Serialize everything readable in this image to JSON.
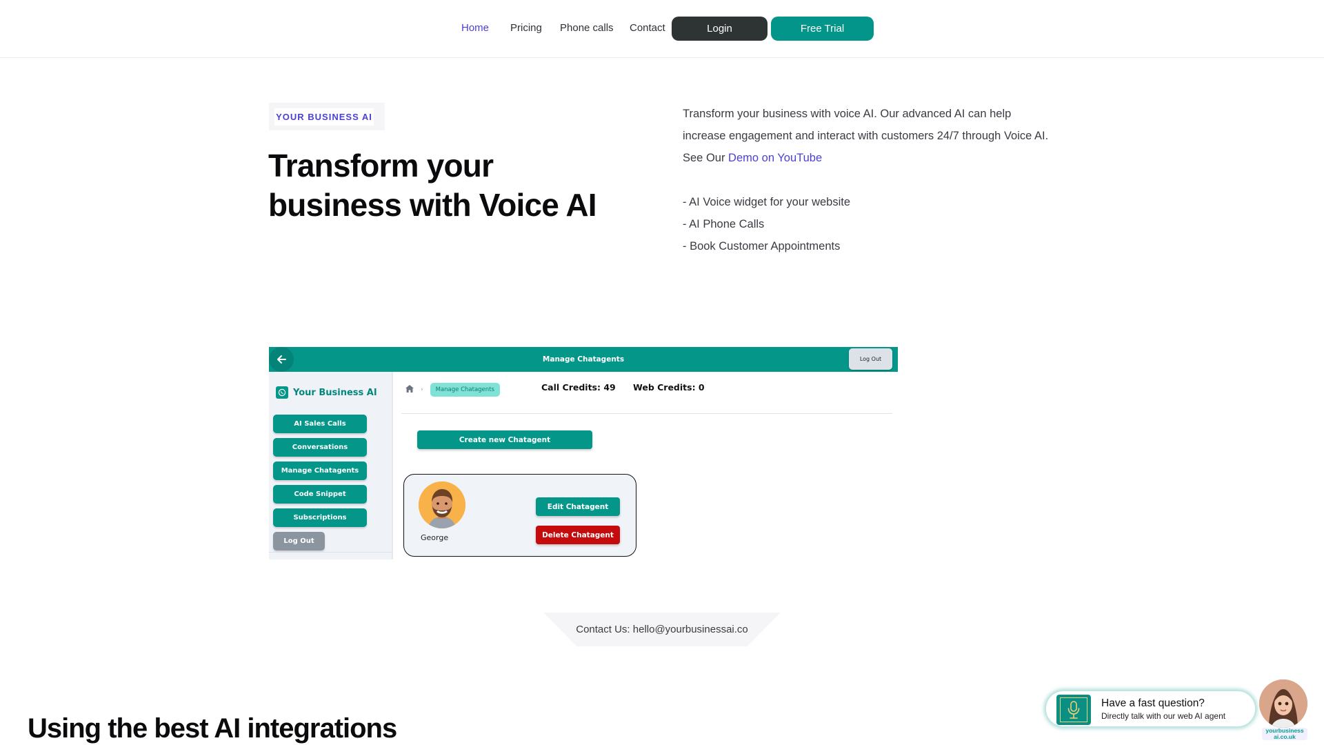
{
  "nav": {
    "items": [
      {
        "label": "Home",
        "active": true
      },
      {
        "label": "Pricing",
        "active": false
      },
      {
        "label": "Phone calls",
        "active": false
      },
      {
        "label": "Contact",
        "active": false
      }
    ],
    "login_label": "Login",
    "trial_label": "Free Trial"
  },
  "hero": {
    "badge": "YOUR BUSINESS AI",
    "title": "Transform your business with Voice AI",
    "description": "Transform your business with voice AI. Our advanced AI can help increase engagement and interact with customers 24/7 through Voice AI.",
    "demo_prefix": "See Our ",
    "demo_link": "Demo on YouTube",
    "features": [
      "- AI Voice widget for your website",
      "- AI Phone Calls",
      "- Book Customer Appointments"
    ]
  },
  "app_preview": {
    "header_title": "Manage Chatagents",
    "back_icon": "arrow-left-icon",
    "logout_top": "Log Out",
    "brand": "Your Business AI",
    "brand_icon": "whatsapp-icon",
    "sidebar_buttons": [
      "AI Sales Calls",
      "Conversations",
      "Manage Chatagents",
      "Code Snippet",
      "Subscriptions"
    ],
    "sidebar_logout": "Log Out",
    "breadcrumb_home_icon": "home-icon",
    "breadcrumb_current": "Manage Chatagents",
    "call_credits": "Call Credits: 49",
    "web_credits": "Web Credits: 0",
    "create_button": "Create new Chatagent",
    "agent": {
      "name": "George",
      "edit_label": "Edit Chatagent",
      "delete_label": "Delete Chatagent"
    }
  },
  "contact": "Contact Us: hello@yourbusinessai.co",
  "section_title": "Using the best AI integrations",
  "widget": {
    "title": "Have a fast question?",
    "subtitle": "Directly talk with our web AI agent",
    "brand": "yourbusiness ai.co.uk",
    "icon": "microphone-icon"
  },
  "colors": {
    "accent": "#4a3fd6",
    "teal": "#05968a",
    "dark": "#2e3434",
    "danger": "#c50b0b"
  }
}
